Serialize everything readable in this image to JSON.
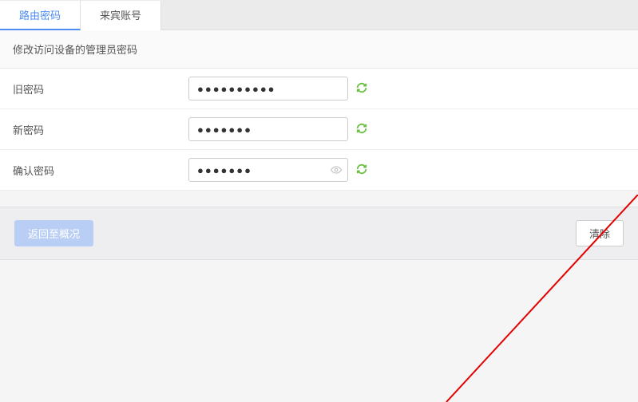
{
  "tabs": {
    "active": "路由密码",
    "inactive": "来宾账号"
  },
  "description": "修改访问设备的管理员密码",
  "fields": {
    "old_password": {
      "label": "旧密码",
      "value": "●●●●●●●●●●"
    },
    "new_password": {
      "label": "新密码",
      "value": "●●●●●●●"
    },
    "confirm_password": {
      "label": "确认密码",
      "value": "●●●●●●●"
    }
  },
  "buttons": {
    "back": "返回至概况",
    "clear": "清除"
  }
}
